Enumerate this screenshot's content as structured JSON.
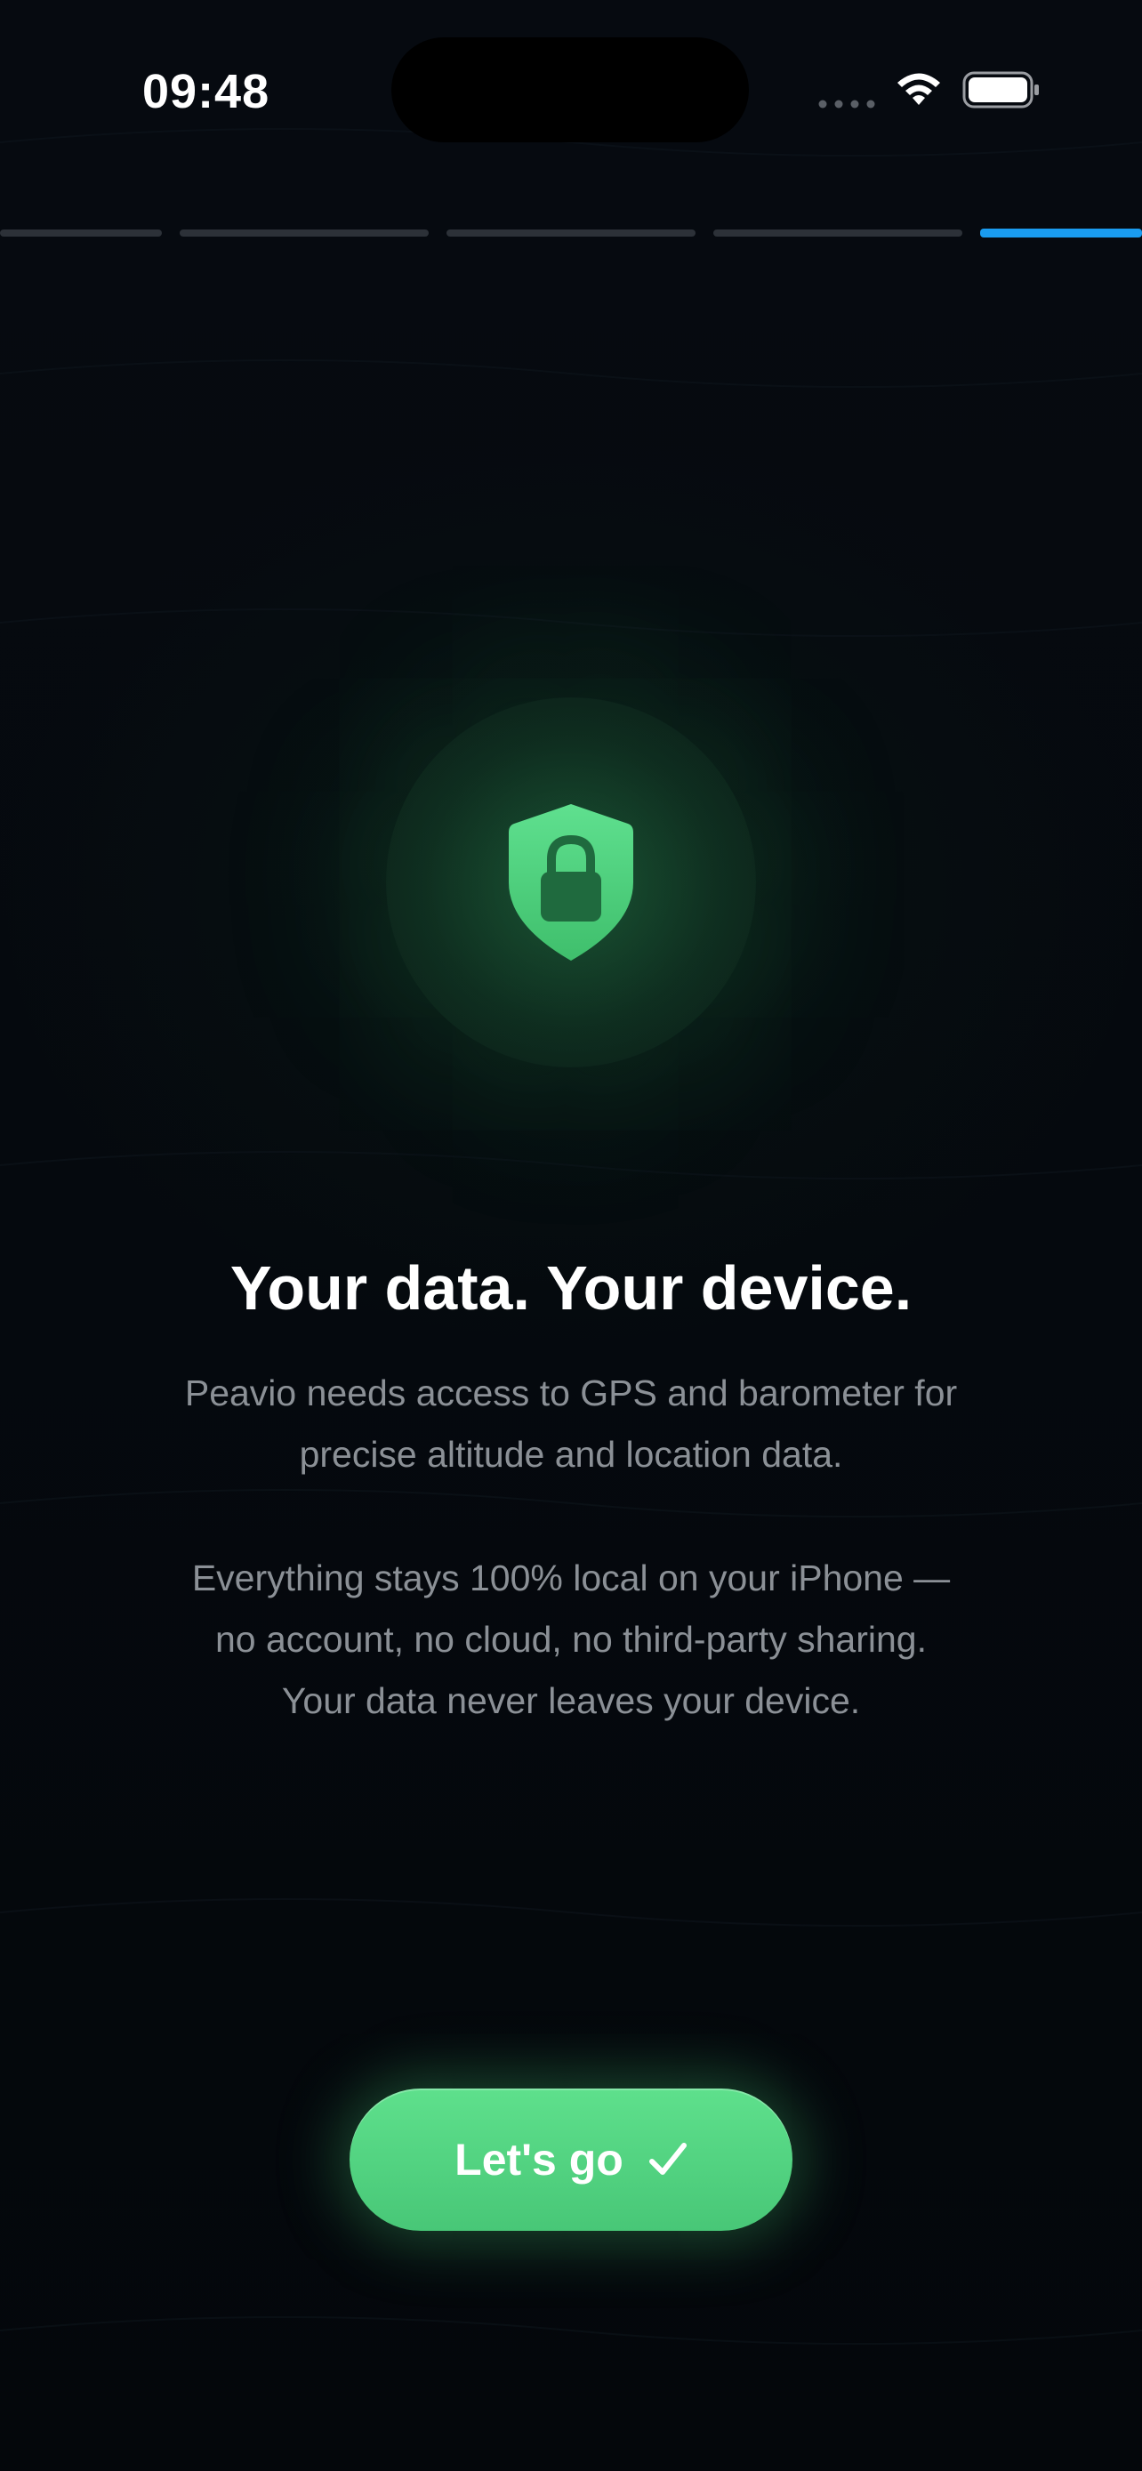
{
  "status_bar": {
    "time": "09:48"
  },
  "onboarding": {
    "step_count": 5,
    "current_step": 5
  },
  "icon": "shield-lock-icon",
  "title": "Your data. Your device.",
  "paragraph_1_lines": [
    "Peavio needs access to GPS and barometer for",
    "precise altitude and location data."
  ],
  "paragraph_2_lines": [
    "Everything stays 100% local on your iPhone —",
    "no account, no cloud, no third-party sharing.",
    "Your data never leaves your device."
  ],
  "cta": {
    "label": "Let's go",
    "icon": "checkmark-icon"
  },
  "colors": {
    "background": "#05080d",
    "accent_green": "#4fd27e",
    "progress_active": "#1a9cf0",
    "progress_inactive": "#2c3138",
    "body_text": "#8b9096"
  }
}
